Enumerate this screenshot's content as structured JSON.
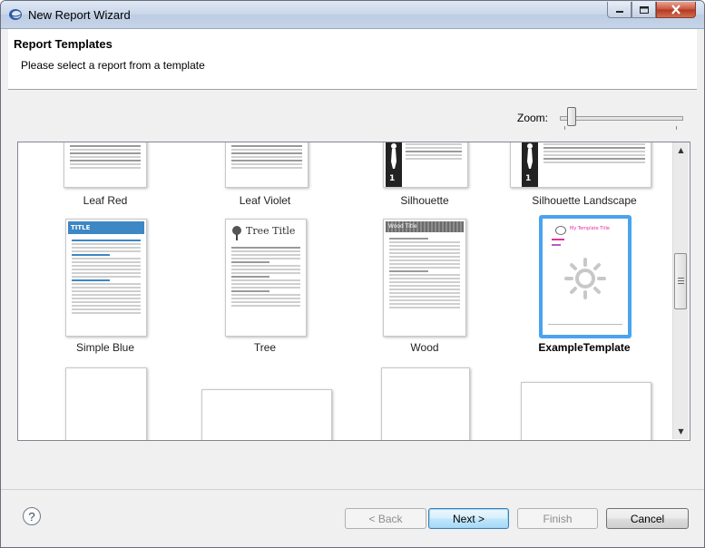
{
  "window": {
    "title": "New Report Wizard",
    "icon": "eclipse-app-icon"
  },
  "header": {
    "title": "Report Templates",
    "subtitle": "Please select a report from a template"
  },
  "zoom": {
    "label": "Zoom:",
    "level": 0.1
  },
  "templates": [
    {
      "label": "Leaf Red",
      "selected": false
    },
    {
      "label": "Leaf Violet",
      "selected": false
    },
    {
      "label": "Silhouette",
      "selected": false
    },
    {
      "label": "Silhouette Landscape",
      "selected": false
    },
    {
      "label": "Simple Blue",
      "selected": false,
      "preview_title": "TITLE"
    },
    {
      "label": "Tree",
      "selected": false,
      "preview_title": "Tree Title"
    },
    {
      "label": "Wood",
      "selected": false,
      "preview_title": "Wood Title"
    },
    {
      "label": "ExampleTemplate",
      "selected": true,
      "preview_title": "My Template Title"
    }
  ],
  "buttons": {
    "back": "< Back",
    "next": "Next >",
    "finish": "Finish",
    "cancel": "Cancel",
    "help": "?"
  },
  "colors": {
    "selection": "#4aa3ee",
    "simple_blue_header": "#3d87c4",
    "example_title": "#e0309c"
  }
}
